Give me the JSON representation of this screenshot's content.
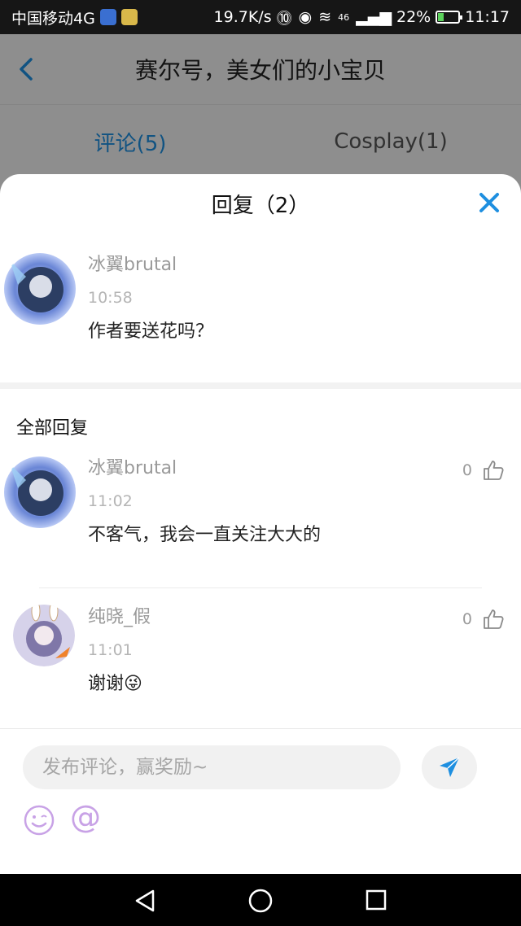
{
  "status_bar": {
    "carrier": "中国移动4G",
    "speed": "19.7K/s",
    "signal": "46",
    "battery_percent": "22%",
    "time": "11:17"
  },
  "background_page": {
    "title": "赛尔号，美女们的小宝贝",
    "tabs": [
      {
        "label": "评论(5)",
        "active": true
      },
      {
        "label": "Cosplay(1)",
        "active": false
      }
    ],
    "accent": "#1e8fe0"
  },
  "sheet": {
    "title": "回复（2）",
    "original": {
      "username": "冰翼brutal",
      "time": "10:58",
      "text": "作者要送花吗？"
    },
    "section_title": "全部回复",
    "replies": [
      {
        "username": "冰翼brutal",
        "time": "11:02",
        "text": "不客气，我会一直关注大大的",
        "likes": "0"
      },
      {
        "username": "纯晓_假",
        "time": "11:01",
        "text": "谢谢😜",
        "likes": "0"
      }
    ]
  },
  "composer": {
    "placeholder": "发布评论，赢奖励~",
    "at_symbol": "@",
    "icons": [
      "send-icon",
      "emoji-icon",
      "at-icon"
    ]
  },
  "nav_bar": {
    "icons": [
      "back-triangle-icon",
      "home-circle-icon",
      "recents-square-icon"
    ]
  }
}
